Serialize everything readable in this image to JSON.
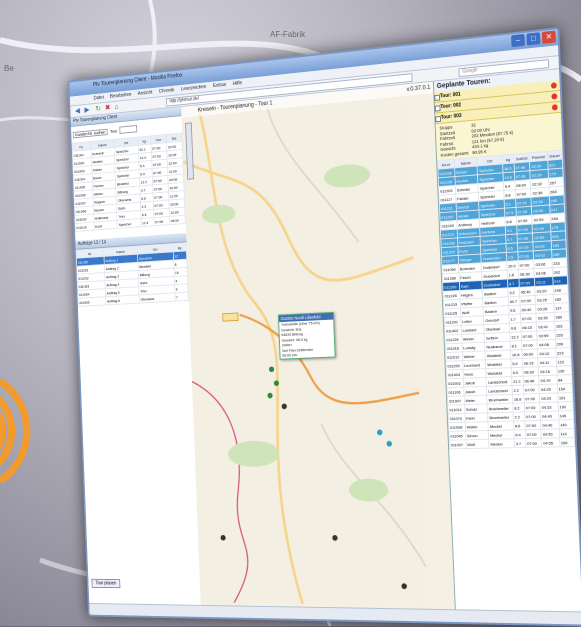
{
  "window": {
    "title": "Ptv Tourenplanung Client - Mozilla Firefox",
    "menu": [
      "Datei",
      "Bearbeiten",
      "Ansicht",
      "Chronik",
      "Lesezeichen",
      "Extras",
      "Hilfe"
    ],
    "address": "http://ptvtour.de/",
    "search_placeholder": "Google"
  },
  "background": {
    "label_top": "AF-Fabrik",
    "label_left": "Be"
  },
  "left_panel": {
    "title": "Ptv Tourenplanung Client",
    "filter_label": "Kunden Nr. suchen",
    "tour_label": "Tour",
    "columns": [
      "Nr.",
      "Name",
      "Ort",
      "kg",
      "Volumen",
      "Von",
      "Bis"
    ],
    "rows": [
      [
        "011001",
        "Schmidt",
        "Speicher",
        "32.1",
        "07:00",
        "10:00"
      ],
      [
        "011002",
        "Mueller",
        "Speicher",
        "14.4",
        "07:00",
        "10:00"
      ],
      [
        "011003",
        "Kaiser",
        "Speicher",
        "5.4",
        "07:00",
        "12:00"
      ],
      [
        "011004",
        "Bauer",
        "Speicher",
        "9.0",
        "07:00",
        "11:00"
      ],
      [
        "011005",
        "Fischer",
        "Binsfeld",
        "12.2",
        "07:00",
        "09:00"
      ],
      [
        "011006",
        "Weber",
        "Bitburg",
        "4.7",
        "07:00",
        "10:00"
      ],
      [
        "011007",
        "Wagner",
        "Oberweis",
        "8.8",
        "07:00",
        "11:00"
      ],
      [
        "011008",
        "Becker",
        "Sülm",
        "2.3",
        "07:00",
        "10:00"
      ],
      [
        "011009",
        "Hoffmann",
        "Trier",
        "6.6",
        "07:00",
        "12:00"
      ],
      [
        "011010",
        "Koch",
        "Speicher",
        "11.5",
        "07:00",
        "09:00"
      ]
    ],
    "lower_title": "Aufträge 12 / 14",
    "lower_columns": [
      "Nr.",
      "Name",
      "Ort",
      "kg",
      "Volumen"
    ],
    "lower_rows": [
      [
        "011050",
        "Auftrag 1",
        "Speicher",
        "12"
      ],
      [
        "011051",
        "Auftrag 2",
        "Binsfeld",
        "8"
      ],
      [
        "011052",
        "Auftrag 3",
        "Bitburg",
        "15"
      ],
      [
        "011053",
        "Auftrag 4",
        "Sülm",
        "4"
      ],
      [
        "011054",
        "Auftrag 5",
        "Trier",
        "9"
      ],
      [
        "011055",
        "Auftrag 6",
        "Oberweis",
        "7"
      ]
    ],
    "button_label": "Tour planen"
  },
  "map": {
    "title": "Kreiseln - Tourenplanung - Tour 1",
    "version": "v.0.37.0.1",
    "popup": {
      "header": "011050 Nordl Lilienfeld",
      "lines": [
        "Transetalle (Uber 75 erh)",
        "Gewicht: 50a",
        "54634 Bitburg",
        "Gewicht: 98.5 kg",
        "Zeiten:",
        "Soll    Plan  Zeitfenster",
        "08:00 Uhr"
      ]
    }
  },
  "right_panel": {
    "title": "Geplante Touren:",
    "tours": [
      "Tour: 001",
      "Tour: 002",
      "Tour: 003"
    ],
    "summary": [
      [
        "Stopps",
        "32"
      ],
      [
        "Startzeit",
        "02:00 Uhr"
      ],
      [
        "Fahrzeit",
        "202 Minuten (87.75 €)"
      ],
      [
        "Fahrstr.",
        "121 km (57.20 €)"
      ],
      [
        "Gewicht",
        "434.1 kg"
      ],
      [
        "Kosten gesamt",
        "90.95 €"
      ]
    ],
    "columns": [
      "Kd.nr",
      "Name",
      "Ort",
      "kg",
      "Soll/Ist",
      "Plan/Ist",
      "Dauer"
    ],
    "rows": [
      [
        "011208",
        "Scharf",
        "Speicher",
        "38.5",
        "07:46",
        "02:34",
        "321"
      ],
      [
        "011238",
        "Henkel",
        "Speicher",
        "14.6",
        "07:46",
        "02:29",
        "175"
      ],
      [
        "011203",
        "Schmitz",
        "Speicher",
        "5.4",
        "08:00",
        "02:32",
        "257"
      ],
      [
        "011117",
        "Fabian",
        "Speicher",
        "8.8",
        "07:00",
        "02:38",
        "283"
      ],
      [
        "011211",
        "Dierich",
        "Speicher",
        "5.1",
        "07:20",
        "02:39",
        "290"
      ],
      [
        "011232",
        "Henke",
        "Speicher",
        "97.5",
        "07:05",
        "02:40",
        "241"
      ],
      [
        "011029",
        "Anthony",
        "Herforst",
        "8.8",
        "07:00",
        "02:53",
        "248"
      ],
      [
        "011223",
        "Schumann",
        "Herforst",
        "3.1",
        "07:00",
        "02:54",
        "179"
      ],
      [
        "011248",
        "Hosbach",
        "Speicher",
        "4.7",
        "07:05",
        "02:59",
        "205"
      ],
      [
        "011203",
        "Kurtz",
        "Speicher",
        "6.5",
        "07:00",
        "03:00",
        "189"
      ],
      [
        "011177",
        "Olinger",
        "Orenhofen",
        "1.5",
        "07:00",
        "03:02",
        "186"
      ],
      [
        "011094",
        "Bohnden",
        "Dudeldorf",
        "20.0",
        "07:00",
        "03:06",
        "233"
      ],
      [
        "011280",
        "Fesch",
        "Dudeldorf",
        "1.8",
        "06:30",
        "03:06",
        "202"
      ],
      [
        "011283",
        "Rath",
        "Dudeldorf",
        "8.7",
        "07:00",
        "03:11",
        "214"
      ],
      [
        "011228",
        "Hilgers",
        "Badem",
        "3.2",
        "05:40",
        "03:20",
        "148"
      ],
      [
        "011215",
        "Pfeffer",
        "Badem",
        "40.7",
        "07:00",
        "03:25",
        "182"
      ],
      [
        "011125",
        "Wolf",
        "Badem",
        "9.5",
        "05:40",
        "03:28",
        "137"
      ],
      [
        "011201",
        "Lutter",
        "Gondorf",
        "1.7",
        "07:00",
        "03:35",
        "289"
      ],
      [
        "011402",
        "Lambert",
        "Oberkail",
        "9.8",
        "06:15",
        "03:41",
        "163"
      ],
      [
        "011226",
        "Weber",
        "Seffern",
        "12.2",
        "07:00",
        "03:59",
        "226"
      ],
      [
        "011016",
        "Ludwig",
        "Nusbaum",
        "8.1",
        "07:00",
        "04:08",
        "200"
      ],
      [
        "011012",
        "Weber",
        "Wolsfeld",
        "10.8",
        "06:00",
        "04:12",
        "223"
      ],
      [
        "011209",
        "Leonhard",
        "Wolsfeld",
        "5.0",
        "06:15",
        "04:11",
        "123"
      ],
      [
        "011404",
        "Hess",
        "Wolsfeld",
        "5.0",
        "06:30",
        "04:16",
        "130"
      ],
      [
        "011003",
        "Jakob",
        "Landscheid",
        "21.2",
        "06:48",
        "04:19",
        "84"
      ],
      [
        "011106",
        "Jakob",
        "Landscheid",
        "2.2",
        "07:00",
        "04:25",
        "154"
      ],
      [
        "011007",
        "Meier",
        "Bruchweiler",
        "18.8",
        "07:00",
        "04:29",
        "151"
      ],
      [
        "011014",
        "Schulz",
        "Bruchweiler",
        "8.2",
        "07:00",
        "04:33",
        "130"
      ],
      [
        "011074",
        "Klein",
        "Bruchweiler",
        "2.2",
        "07:00",
        "04:40",
        "149"
      ],
      [
        "011008",
        "Wolter",
        "Meckel",
        "8.6",
        "07:00",
        "04:46",
        "149"
      ],
      [
        "011045",
        "Simon",
        "Meckel",
        "6.4",
        "07:00",
        "04:50",
        "114"
      ],
      [
        "011007",
        "Wolf",
        "Meckel",
        "3.7",
        "07:00",
        "04:55",
        "169"
      ]
    ]
  },
  "colors": {
    "accent": "#1e63b6",
    "highlight": "#4fa4d8",
    "route": "#f0a04a",
    "signal": "#f39a2a"
  }
}
